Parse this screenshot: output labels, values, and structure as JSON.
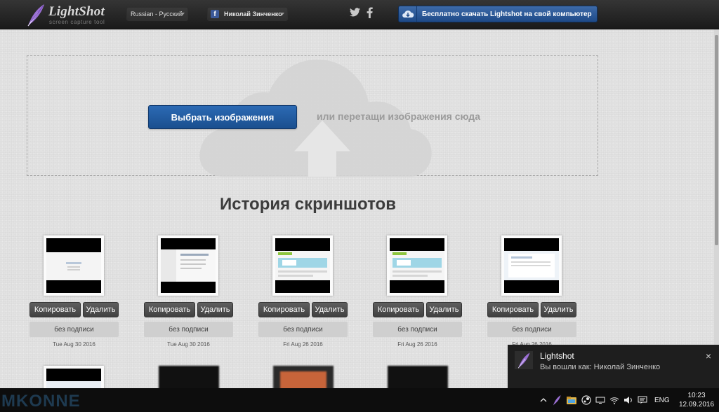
{
  "header": {
    "logo_name": "LightShot",
    "logo_tagline": "screen capture tool",
    "language": "Russian - Русский",
    "user_name": "Николай Зинченко",
    "fb_letter": "f",
    "download_label": "Бесплатно скачать Lightshot на свой компьютер",
    "twitter_icon": "twitter-icon",
    "facebook_icon": "facebook-icon"
  },
  "upload": {
    "select_label": "Выбрать изображения",
    "drop_hint": "или перетащи изображения сюда"
  },
  "history": {
    "title": "История скриншотов",
    "items": [
      {
        "copy": "Копировать",
        "delete": "Удалить",
        "caption": "без подписи",
        "date": "Tue Aug 30 2016"
      },
      {
        "copy": "Копировать",
        "delete": "Удалить",
        "caption": "без подписи",
        "date": "Tue Aug 30 2016"
      },
      {
        "copy": "Копировать",
        "delete": "Удалить",
        "caption": "без подписи",
        "date": "Fri Aug 26 2016"
      },
      {
        "copy": "Копировать",
        "delete": "Удалить",
        "caption": "без подписи",
        "date": "Fri Aug 26 2016"
      },
      {
        "copy": "Копировать",
        "delete": "Удалить",
        "caption": "без подписи",
        "date": "Fri Aug 26 2016"
      }
    ]
  },
  "toast": {
    "title": "Lightshot",
    "message": "Вы вошли как: Николай Зинченко",
    "close": "×"
  },
  "taskbar": {
    "watermark": "MKONNE",
    "language": "ENG",
    "time": "10:23",
    "date": "12.09.2016"
  },
  "colors": {
    "accent_blue": "#1e4a88",
    "header_bg": "#1a1a1a",
    "page_bg": "#e2e2e2"
  }
}
